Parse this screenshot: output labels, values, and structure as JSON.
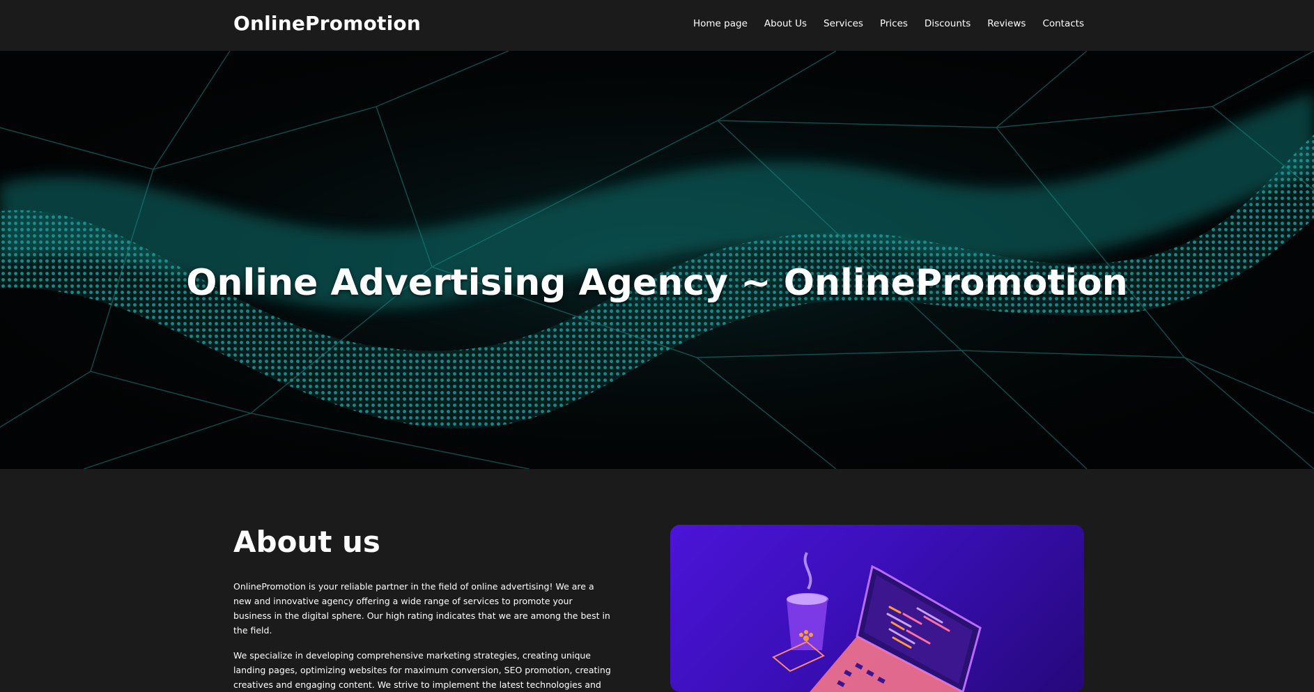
{
  "header": {
    "logo": "OnlinePromotion",
    "nav": [
      "Home page",
      "About Us",
      "Services",
      "Prices",
      "Discounts",
      "Reviews",
      "Contacts"
    ]
  },
  "hero": {
    "title": "Online Advertising Agency ~ OnlinePromotion"
  },
  "about": {
    "heading": "About us",
    "paragraph1": "OnlinePromotion is your reliable partner in the field of online advertising! We are a new and innovative agency offering a wide range of services to promote your business in the digital sphere. Our high rating indicates that we are among the best in the field.",
    "paragraph2": "We specialize in developing comprehensive marketing strategies, creating unique landing pages, optimizing websites for maximum conversion, SEO promotion, creating creatives and engaging content. We strive to implement the latest technologies and"
  },
  "colors": {
    "background": "#1b1b1b",
    "accent_teal": "#1fa3a0",
    "illustration_purple": "#4c14d8"
  }
}
